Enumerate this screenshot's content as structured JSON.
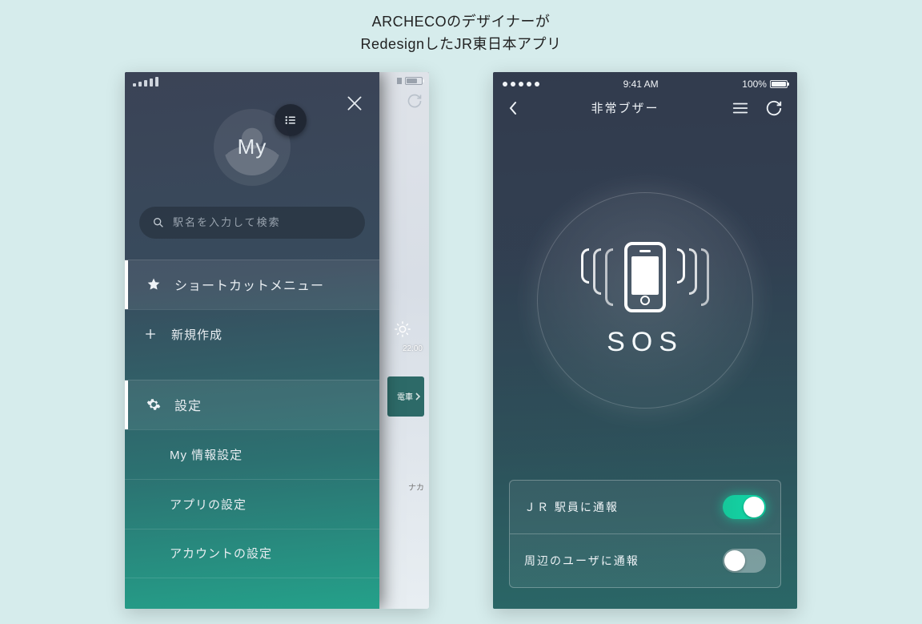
{
  "title": {
    "line1": "ARCHECOのデザイナーが",
    "line2": "RedesignしたJR東日本アプリ"
  },
  "phone1": {
    "avatar_label": "My",
    "search": {
      "placeholder": "駅名を入力して検索"
    },
    "menu1": {
      "header": "ショートカットメニュー",
      "item1": "新規作成"
    },
    "menu2": {
      "header": "設定",
      "item1": "My 情報設定",
      "item2": "アプリの設定",
      "item3": "アカウントの設定"
    },
    "peek": {
      "time": "22:00",
      "chip_label": "電車",
      "caption": "ナカ"
    }
  },
  "phone2": {
    "status": {
      "time": "9:41 AM",
      "battery": "100%"
    },
    "nav": {
      "title": "非常ブザー"
    },
    "sos_label": "SOS",
    "toggles": {
      "row1": {
        "label": "ＪＲ 駅員に通報",
        "on": true
      },
      "row2": {
        "label": "周辺のユーザに通報",
        "on": false
      }
    }
  }
}
